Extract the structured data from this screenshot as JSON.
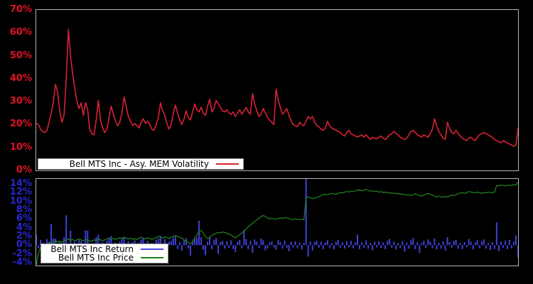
{
  "colors": {
    "background": "#000000",
    "plot_border": "#b4b4b4",
    "volatility_line": "#d62234",
    "volatility_labels": "#e01327",
    "return_bars": "#4040d8",
    "return_labels": "#2727cf",
    "price_line": "#1f7d1f",
    "legend_background": "#ffffff",
    "legend_text": "#000000"
  },
  "chart_data": [
    {
      "type": "line",
      "title": "Bell MTS Inc - Asy. MEM Volatility",
      "legend": "Bell MTS Inc - Asy. MEM Volatility",
      "legend_position": "bottom-left-inside",
      "grid": false,
      "xlabel": "",
      "ylabel": "",
      "ylim": [
        0,
        70
      ],
      "yticks": [
        {
          "value": 70,
          "label": "70%"
        },
        {
          "value": 60,
          "label": "60%"
        },
        {
          "value": 50,
          "label": "50%"
        },
        {
          "value": 40,
          "label": "40%"
        },
        {
          "value": 30,
          "label": "30%"
        },
        {
          "value": 20,
          "label": "20%"
        },
        {
          "value": 10,
          "label": "10%"
        },
        {
          "value": 0,
          "label": "0%"
        }
      ],
      "values": [
        20.5,
        20,
        18,
        17,
        16.5,
        17.5,
        21,
        25,
        30,
        37.5,
        34,
        26,
        21,
        24,
        40,
        61.5,
        50,
        42,
        36,
        30,
        27,
        29.5,
        24,
        29.5,
        26.5,
        18,
        16,
        15.5,
        22,
        30.5,
        22,
        18.5,
        16.5,
        18,
        23,
        28,
        24.5,
        21.5,
        19.5,
        21,
        25,
        32,
        28,
        23.5,
        21.5,
        19.5,
        20.5,
        19.5,
        18.5,
        21,
        22.5,
        20.5,
        21.5,
        20,
        18,
        17.5,
        20,
        23,
        29.5,
        26,
        24,
        20.5,
        18,
        20,
        25,
        28.5,
        25,
        22,
        20,
        22.5,
        26,
        23,
        22,
        25.5,
        29,
        26.5,
        25.5,
        27.5,
        25,
        24,
        28,
        31,
        25.5,
        27,
        30.5,
        29,
        27.5,
        26,
        25.5,
        26.5,
        25,
        24.5,
        25.5,
        23.5,
        25,
        26.5,
        24.5,
        26,
        27.5,
        25.5,
        24.5,
        33.5,
        29,
        26,
        23.5,
        24.5,
        27,
        25,
        23,
        22,
        21,
        20,
        35.5,
        30.5,
        27.5,
        24.5,
        25.5,
        27,
        24,
        21.5,
        20,
        19.5,
        19,
        21,
        20,
        19.5,
        21.5,
        23.5,
        22.5,
        23.5,
        21,
        19.5,
        19,
        18,
        17.5,
        18.5,
        21.5,
        19.5,
        18.5,
        18,
        17.5,
        17,
        16.5,
        15.5,
        15,
        16.5,
        17.5,
        16,
        15.5,
        15,
        14.5,
        15,
        15.5,
        14.5,
        15.5,
        14.5,
        13.5,
        14.5,
        14,
        13.8,
        14.5,
        15,
        14,
        13.5,
        14.5,
        15.5,
        16,
        17,
        16,
        15.5,
        14.5,
        14,
        13.5,
        14,
        15.5,
        17,
        17.5,
        16.5,
        15.5,
        15,
        14.5,
        15.5,
        15,
        14.5,
        16,
        18,
        22.5,
        19.5,
        17,
        15.5,
        14,
        13.5,
        21,
        18.5,
        16.5,
        16,
        17.5,
        16,
        15,
        14,
        13.5,
        13,
        14,
        14.5,
        13.5,
        13,
        14.5,
        15.5,
        16,
        16.5,
        16,
        15.5,
        15,
        14.5,
        13.5,
        13,
        12.5,
        12,
        13,
        12.5,
        12,
        11.5,
        11,
        10.5,
        11,
        18.5
      ]
    },
    {
      "type": "bar+line",
      "title": "Bell MTS Inc Return and Price",
      "legend_position": "bottom-left-inside",
      "grid": false,
      "xlabel": "",
      "ylabel": "",
      "ylim": [
        -4.65,
        15.1
      ],
      "yticks": [
        {
          "value": 14,
          "label": "14%"
        },
        {
          "value": 12,
          "label": "12%"
        },
        {
          "value": 10,
          "label": "10%"
        },
        {
          "value": 8,
          "label": "8%"
        },
        {
          "value": 6,
          "label": "6%"
        },
        {
          "value": 4,
          "label": "4%"
        },
        {
          "value": 2,
          "label": "2%"
        },
        {
          "value": 0,
          "label": "0%"
        },
        {
          "value": -2,
          "label": "-2%"
        },
        {
          "value": -4,
          "label": "-4%"
        }
      ],
      "series": [
        {
          "name": "Bell MTS Inc Return",
          "render": "bar",
          "values": [
            2.3,
            -0.7,
            1.2,
            0.5,
            -0.9,
            1.4,
            0.8,
            4.8,
            1.6,
            1.5,
            -1.2,
            0.6,
            -0.5,
            1.8,
            6.8,
            -1.4,
            3.3,
            -2.9,
            0.8,
            -0.6,
            1.2,
            0.9,
            -0.8,
            3.4,
            3.3,
            -1.1,
            0.5,
            -0.4,
            1.8,
            2.4,
            -0.9,
            0.7,
            -0.6,
            1.0,
            1.5,
            2.1,
            -0.8,
            0.6,
            -1.0,
            0.8,
            1.4,
            1.9,
            -0.7,
            0.9,
            -0.5,
            0.7,
            1.1,
            -0.9,
            0.6,
            1.3,
            1.6,
            -0.6,
            1.0,
            -0.8,
            0.5,
            -0.7,
            1.2,
            1.5,
            2.2,
            -1.0,
            1.4,
            -0.6,
            0.8,
            1.0,
            1.7,
            2.0,
            -0.9,
            0.7,
            -1.3,
            1.1,
            1.6,
            -0.8,
            -2.4,
            0.9,
            1.4,
            1.8,
            5.6,
            1.8,
            -1.1,
            -2.3,
            0.8,
            1.9,
            -0.9,
            1.2,
            1.6,
            -2.0,
            0.7,
            1.0,
            -0.8,
            0.9,
            -0.6,
            1.1,
            -0.9,
            -1.6,
            0.8,
            1.2,
            -0.7,
            3.5,
            1.4,
            -0.9,
            1.0,
            -1.8,
            1.3,
            0.8,
            -0.7,
            1.5,
            1.1,
            -1.2,
            -0.8,
            0.6,
            0.9,
            -0.5,
            -1.0,
            1.2,
            0.7,
            -0.8,
            1.0,
            -0.6,
            -1.4,
            0.8,
            -0.5,
            0.9,
            -0.7,
            0.6,
            -1.0,
            0.5,
            15.1,
            -2.6,
            0.9,
            -1.2,
            0.7,
            1.0,
            -0.6,
            0.8,
            -0.9,
            0.6,
            1.1,
            -0.7,
            0.5,
            -1.0,
            0.8,
            1.2,
            -0.6,
            0.7,
            -0.8,
            0.9,
            -0.5,
            1.0,
            -0.7,
            0.6,
            2.4,
            -0.9,
            0.7,
            -0.6,
            1.1,
            -0.8,
            0.5,
            -1.2,
            0.8,
            -0.5,
            0.9,
            -0.7,
            0.6,
            -0.9,
            1.0,
            1.4,
            -0.6,
            0.8,
            -1.0,
            0.5,
            -0.7,
            0.9,
            -1.5,
            0.6,
            -0.8,
            1.1,
            1.6,
            -0.9,
            0.7,
            -1.8,
            0.5,
            1.0,
            -0.6,
            1.3,
            0.8,
            -0.7,
            1.5,
            -1.0,
            0.6,
            -0.8,
            0.9,
            -1.2,
            1.8,
            0.7,
            -0.6,
            1.0,
            1.2,
            -0.8,
            0.5,
            -0.9,
            0.7,
            -0.5,
            1.4,
            0.8,
            -1.0,
            0.6,
            1.1,
            -0.7,
            0.9,
            1.3,
            -0.8,
            0.5,
            -1.1,
            0.7,
            -0.9,
            5.2,
            -1.4,
            0.8,
            -0.6,
            1.0,
            -0.9,
            1.2,
            -0.7,
            0.8,
            2.2,
            -2.8
          ]
        },
        {
          "name": "Bell MTS Inc Price",
          "render": "line",
          "values": [
            -4.5,
            -2.0,
            -0.5,
            0.0,
            0.2,
            0.3,
            0.5,
            0.4,
            0.8,
            1.0,
            0.7,
            0.9,
            0.6,
            1.0,
            1.2,
            1.4,
            1.1,
            1.3,
            1.0,
            1.2,
            1.4,
            1.2,
            1.0,
            1.3,
            1.1,
            0.9,
            1.0,
            1.2,
            1.0,
            1.4,
            1.2,
            1.0,
            1.2,
            1.4,
            1.6,
            1.4,
            1.5,
            1.3,
            1.5,
            1.7,
            1.5,
            1.8,
            1.6,
            1.4,
            1.6,
            1.3,
            1.5,
            1.3,
            1.6,
            1.8,
            1.6,
            1.4,
            1.7,
            1.5,
            1.3,
            1.5,
            1.7,
            2.0,
            1.8,
            1.6,
            1.9,
            1.7,
            1.5,
            1.8,
            2.0,
            2.2,
            2.0,
            1.8,
            1.6,
            1.2,
            1.0,
            0.6,
            0.3,
            0.8,
            1.6,
            2.4,
            3.1,
            3.4,
            2.8,
            2.0,
            1.5,
            1.8,
            2.2,
            2.5,
            2.7,
            2.9,
            2.8,
            3.0,
            2.9,
            2.7,
            2.5,
            2.3,
            2.0,
            1.7,
            2.0,
            2.4,
            2.8,
            3.2,
            3.7,
            4.2,
            4.6,
            5.0,
            5.4,
            5.8,
            6.1,
            6.5,
            6.8,
            6.5,
            6.2,
            6.0,
            6.1,
            6.0,
            5.9,
            6.1,
            6.2,
            6.1,
            6.3,
            6.2,
            6.1,
            5.9,
            5.8,
            6.0,
            5.9,
            5.8,
            5.9,
            5.8,
            10.8,
            11.0,
            10.8,
            10.6,
            10.7,
            10.9,
            11.1,
            11.3,
            11.5,
            11.6,
            11.5,
            11.7,
            11.8,
            11.7,
            11.6,
            11.8,
            12.0,
            11.9,
            12.1,
            12.2,
            12.1,
            12.3,
            12.2,
            12.4,
            12.5,
            12.6,
            12.4,
            12.5,
            12.7,
            12.5,
            12.3,
            12.4,
            12.2,
            12.3,
            12.1,
            12.2,
            12.0,
            12.1,
            11.9,
            12.0,
            11.8,
            11.9,
            11.7,
            11.8,
            11.6,
            11.7,
            11.5,
            11.4,
            11.5,
            11.3,
            11.5,
            11.7,
            11.5,
            11.3,
            11.2,
            11.4,
            11.6,
            11.8,
            11.6,
            11.4,
            11.2,
            11.0,
            11.2,
            11.0,
            10.9,
            11.1,
            11.0,
            11.2,
            11.4,
            11.3,
            11.5,
            11.7,
            11.9,
            12.0,
            11.8,
            12.0,
            12.2,
            12.1,
            12.0,
            11.9,
            12.1,
            12.0,
            11.8,
            12.0,
            11.9,
            12.1,
            12.0,
            11.9,
            12.1,
            13.6,
            13.5,
            13.7,
            13.6,
            13.5,
            13.6,
            13.7,
            13.6,
            13.8,
            13.7,
            14.4
          ]
        }
      ]
    }
  ],
  "legend_vol": {
    "label": "Bell MTS Inc - Asy. MEM Volatility"
  },
  "legend_ret": {
    "return_label": "Bell MTS Inc Return",
    "price_label": "Bell MTS Inc Price"
  }
}
